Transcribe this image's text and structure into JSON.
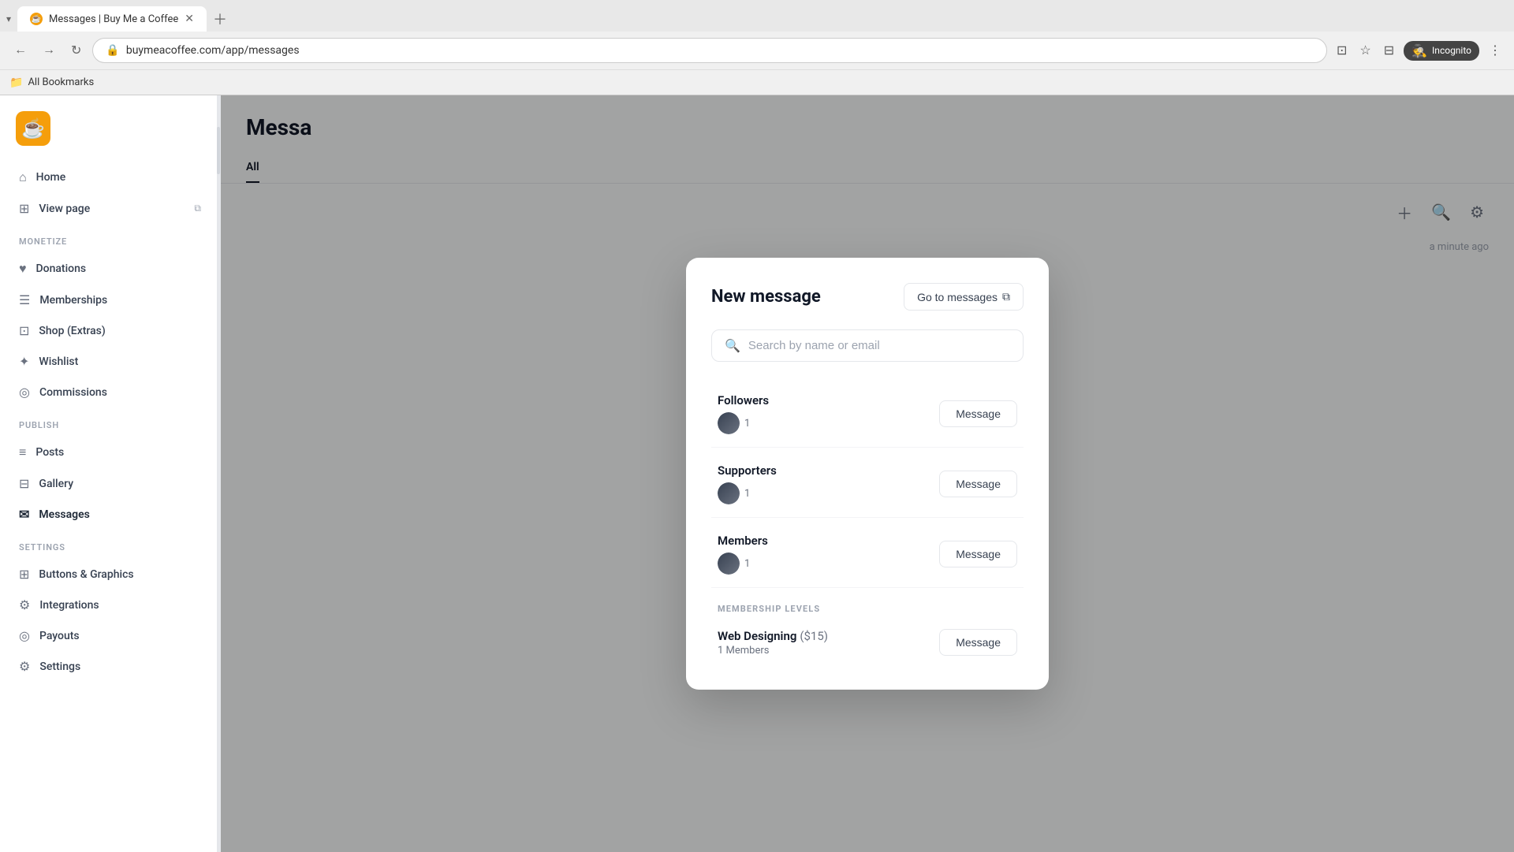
{
  "browser": {
    "tab_title": "Messages | Buy Me a Coffee",
    "tab_favicon": "☕",
    "url": "buymeacoffee.com/app/messages",
    "incognito_label": "Incognito",
    "bookmarks_label": "All Bookmarks"
  },
  "sidebar": {
    "logo_emoji": "☕",
    "nav_items": [
      {
        "id": "home",
        "icon": "⌂",
        "label": "Home",
        "active": false
      },
      {
        "id": "view-page",
        "icon": "⊞",
        "label": "View page",
        "has_external": true,
        "active": false
      }
    ],
    "monetize_label": "MONETIZE",
    "monetize_items": [
      {
        "id": "donations",
        "icon": "♥",
        "label": "Donations",
        "active": false
      },
      {
        "id": "memberships",
        "icon": "☰",
        "label": "Memberships",
        "active": false
      },
      {
        "id": "shop",
        "icon": "⊡",
        "label": "Shop (Extras)",
        "active": false
      },
      {
        "id": "wishlist",
        "icon": "✦",
        "label": "Wishlist",
        "active": false
      },
      {
        "id": "commissions",
        "icon": "◎",
        "label": "Commissions",
        "active": false
      }
    ],
    "publish_label": "PUBLISH",
    "publish_items": [
      {
        "id": "posts",
        "icon": "≡",
        "label": "Posts",
        "active": false
      },
      {
        "id": "gallery",
        "icon": "⊟",
        "label": "Gallery",
        "active": false
      },
      {
        "id": "messages",
        "icon": "✉",
        "label": "Messages",
        "active": true
      }
    ],
    "settings_label": "SETTINGS",
    "settings_items": [
      {
        "id": "buttons-graphics",
        "icon": "⊞",
        "label": "Buttons & Graphics",
        "active": false
      },
      {
        "id": "integrations",
        "icon": "⚙",
        "label": "Integrations",
        "active": false
      },
      {
        "id": "payouts",
        "icon": "◎",
        "label": "Payouts",
        "active": false
      },
      {
        "id": "settings",
        "icon": "⚙",
        "label": "Settings",
        "active": false
      }
    ]
  },
  "main": {
    "page_title": "Messa",
    "tabs": [
      {
        "id": "all",
        "label": "All",
        "active": true
      }
    ],
    "timestamp": "a minute ago"
  },
  "modal": {
    "title": "New message",
    "goto_messages_label": "Go to messages",
    "search_placeholder": "Search by name or email",
    "groups": [
      {
        "id": "followers",
        "name": "Followers",
        "count": 1,
        "button_label": "Message"
      },
      {
        "id": "supporters",
        "name": "Supporters",
        "count": 1,
        "button_label": "Message"
      },
      {
        "id": "members",
        "name": "Members",
        "count": 1,
        "button_label": "Message"
      }
    ],
    "membership_section_label": "MEMBERSHIP LEVELS",
    "memberships": [
      {
        "id": "web-designing",
        "name": "Web Designing",
        "price": "($15)",
        "count_label": "1 Members",
        "button_label": "Message"
      }
    ]
  }
}
